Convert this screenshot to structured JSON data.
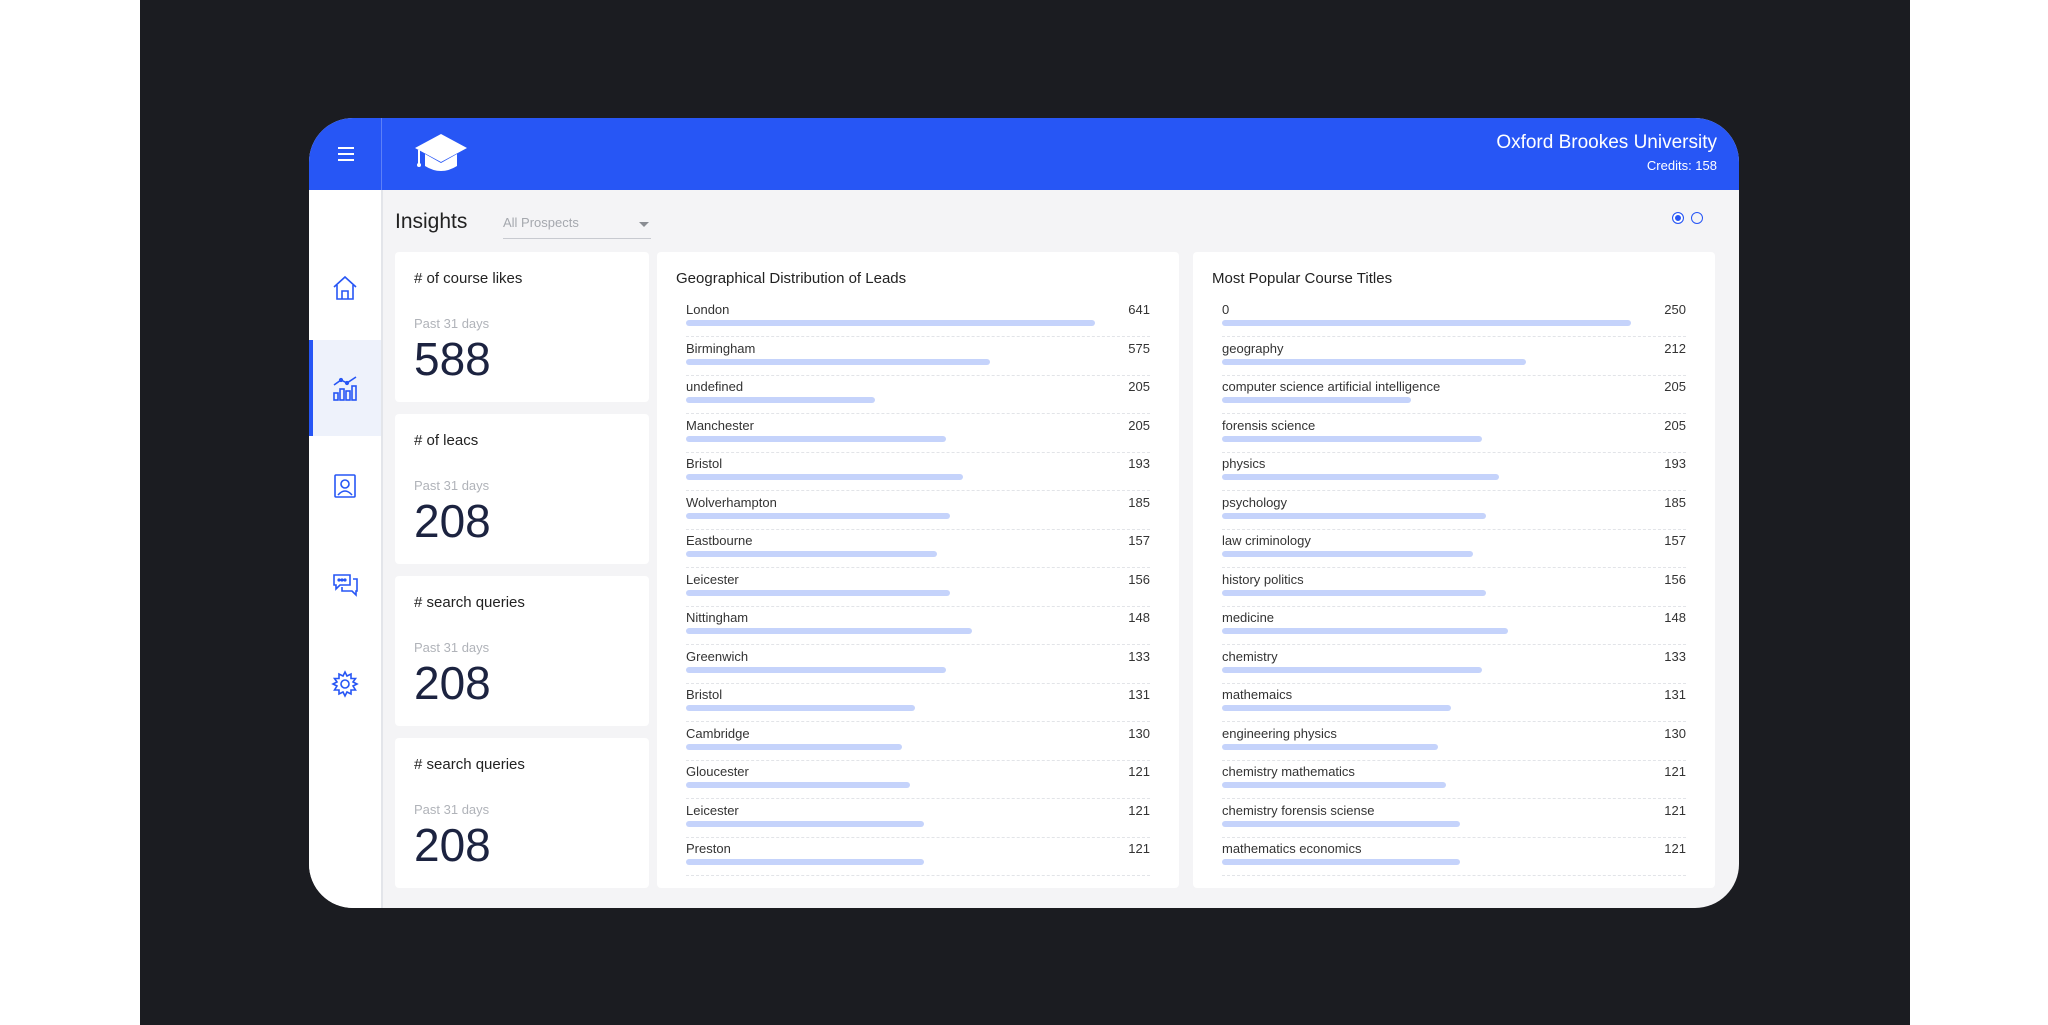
{
  "header": {
    "university": "Oxford Brookes University",
    "credits": "Credits: 158"
  },
  "page": {
    "title": "Insights",
    "filter_placeholder": "All Prospects"
  },
  "icons": {
    "menu": "hamburger-menu-icon",
    "logo": "graduation-cap-icon",
    "nav": [
      "home-icon",
      "analytics-chart-icon",
      "profile-card-icon",
      "chat-bubbles-icon",
      "gear-icon"
    ]
  },
  "colors": {
    "brand": "#2756f5",
    "bar": "#c5d3fb",
    "number": "#1c2340"
  },
  "stats": [
    {
      "label": "# of course likes",
      "period": "Past 31 days",
      "value": "588"
    },
    {
      "label": "# of leacs",
      "period": "Past 31 days",
      "value": "208"
    },
    {
      "label": "# search queries",
      "period": "Past 31 days",
      "value": "208"
    },
    {
      "label": "# search queries",
      "period": "Past 31 days",
      "value": "208"
    }
  ],
  "geo": {
    "title": "Geographical Distribution of Leads",
    "rows": [
      {
        "name": "London",
        "value": "641",
        "fill": 0.93
      },
      {
        "name": "Birmingham",
        "value": "575",
        "fill": 0.69
      },
      {
        "name": "undefined",
        "value": "205",
        "fill": 0.43
      },
      {
        "name": "Manchester",
        "value": "205",
        "fill": 0.59
      },
      {
        "name": "Bristol",
        "value": "193",
        "fill": 0.63
      },
      {
        "name": "Wolverhampton",
        "value": "185",
        "fill": 0.6
      },
      {
        "name": "Eastbourne",
        "value": "157",
        "fill": 0.57
      },
      {
        "name": "Leicester",
        "value": "156",
        "fill": 0.6
      },
      {
        "name": "Nittingham",
        "value": "148",
        "fill": 0.65
      },
      {
        "name": "Greenwich",
        "value": "133",
        "fill": 0.59
      },
      {
        "name": "Bristol",
        "value": "131",
        "fill": 0.52
      },
      {
        "name": "Cambridge",
        "value": "130",
        "fill": 0.49
      },
      {
        "name": "Gloucester",
        "value": "121",
        "fill": 0.51
      },
      {
        "name": "Leicester",
        "value": "121",
        "fill": 0.54
      },
      {
        "name": "Preston",
        "value": "121",
        "fill": 0.54
      }
    ]
  },
  "courses": {
    "title": "Most Popular Course Titles",
    "rows": [
      {
        "name": "0",
        "value": "250",
        "fill": 0.93
      },
      {
        "name": "geography",
        "value": "212",
        "fill": 0.69
      },
      {
        "name": "computer science artificial intelligence",
        "value": "205",
        "fill": 0.43
      },
      {
        "name": "forensis science",
        "value": "205",
        "fill": 0.59
      },
      {
        "name": "physics",
        "value": "193",
        "fill": 0.63
      },
      {
        "name": "psychology",
        "value": "185",
        "fill": 0.6
      },
      {
        "name": "law criminology",
        "value": "157",
        "fill": 0.57
      },
      {
        "name": "history politics",
        "value": "156",
        "fill": 0.6
      },
      {
        "name": "medicine",
        "value": "148",
        "fill": 0.65
      },
      {
        "name": "chemistry",
        "value": "133",
        "fill": 0.59
      },
      {
        "name": "mathemaics",
        "value": "131",
        "fill": 0.52
      },
      {
        "name": "engineering physics",
        "value": "130",
        "fill": 0.49
      },
      {
        "name": "chemistry mathematics",
        "value": "121",
        "fill": 0.51
      },
      {
        "name": "chemistry forensis sciense",
        "value": "121",
        "fill": 0.54
      },
      {
        "name": "mathematics economics",
        "value": "121",
        "fill": 0.54
      }
    ]
  }
}
